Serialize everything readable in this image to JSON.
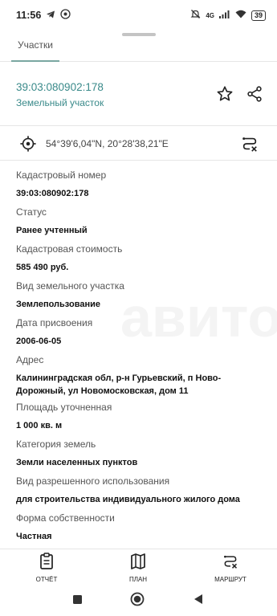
{
  "statusbar": {
    "time": "11:56",
    "network": "4G",
    "battery": "39"
  },
  "tabs": [
    {
      "label": "Участки"
    }
  ],
  "parcel": {
    "number": "39:03:080902:178",
    "type": "Земельный участок"
  },
  "coords": "54°39'6,04\"N, 20°28'38,21\"E",
  "fields": [
    {
      "label": "Кадастровый номер",
      "value": "39:03:080902:178"
    },
    {
      "label": "Статус",
      "value": "Ранее учтенный"
    },
    {
      "label": "Кадастровая стоимость",
      "value": "585 490 руб."
    },
    {
      "label": "Вид земельного участка",
      "value": "Землепользование"
    },
    {
      "label": "Дата присвоения",
      "value": "2006-06-05"
    },
    {
      "label": "Адрес",
      "value": "Калининградская обл, р-н Гурьевский, п Ново-Дорожный, ул Новомосковская, дом 11"
    },
    {
      "label": "Площадь уточненная",
      "value": "1 000 кв. м"
    },
    {
      "label": "Категория земель",
      "value": "Земли населенных пунктов"
    },
    {
      "label": "Вид разрешенного использования",
      "value": "для строительства индивидуального жилого дома"
    },
    {
      "label": "Форма собственности",
      "value": "Частная"
    }
  ],
  "bottomnav": [
    {
      "label": "ОТЧЁТ"
    },
    {
      "label": "ПЛАН"
    },
    {
      "label": "МАРШРУТ"
    }
  ]
}
